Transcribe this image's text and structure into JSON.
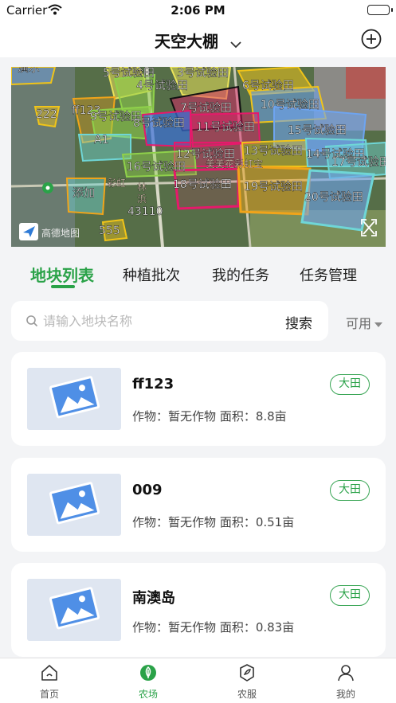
{
  "status_bar": {
    "carrier": "Carrier",
    "time": "2:06 PM"
  },
  "nav": {
    "title": "天空大棚",
    "add_icon": "plus-circle-icon",
    "dropdown_icon": "chevron-down-icon"
  },
  "map": {
    "plots": [
      {
        "label": "5号试验田",
        "color": "#e9e25a"
      },
      {
        "label": "3号试验田",
        "color": "#e9e25a"
      },
      {
        "label": "4号试验田",
        "color": "#8fd14a"
      },
      {
        "label": "6号试验田",
        "color": "#f0c419"
      },
      {
        "label": "7号试验田",
        "color": "#e6196b"
      },
      {
        "label": "10号试验田",
        "color": "#6ea4f0"
      },
      {
        "label": "ff123",
        "color": "#f0a41a"
      },
      {
        "label": "9号试验田",
        "color": "#8fd14a"
      },
      {
        "label": "8号试验田",
        "color": "#3a6fd8"
      },
      {
        "label": "11号试验田",
        "color": "#e6196b"
      },
      {
        "label": "15号试验田",
        "color": "#6ea4f0"
      },
      {
        "label": "222",
        "color": "#f0c419"
      },
      {
        "label": "A1",
        "color": "#6fd6d6"
      },
      {
        "label": "12号试验田",
        "color": "#e6196b"
      },
      {
        "label": "13号试验田",
        "color": "#f0c419"
      },
      {
        "label": "14号试验田",
        "color": "#6ea4f0"
      },
      {
        "label": "17号试验田",
        "color": "#6fd6d6"
      },
      {
        "label": "16号试验田",
        "color": "#8fd14a"
      },
      {
        "label": "18号试验田",
        "color": "#e6196b"
      },
      {
        "label": "19号试验田",
        "color": "#f0a41a"
      },
      {
        "label": "20号试验田",
        "color": "#6fd6d6"
      },
      {
        "label": "添加",
        "color": "#f0a41a"
      },
      {
        "label": "555",
        "color": "#f0c419"
      },
      {
        "label": "43110",
        "color": "#ffffff"
      },
      {
        "label": "演示",
        "color": "#f0c419"
      }
    ],
    "place_labels": [
      "美美花彩虹宝",
      "彩虹",
      "林",
      "浜"
    ],
    "watermark": "高德地图",
    "locate_icon": "navigation-arrow-icon",
    "fullscreen_icon": "expand-icon"
  },
  "tabs": [
    {
      "label": "地块列表",
      "active": true
    },
    {
      "label": "种植批次",
      "active": false
    },
    {
      "label": "我的任务",
      "active": false
    },
    {
      "label": "任务管理",
      "active": false
    }
  ],
  "search": {
    "placeholder": "请输入地块名称",
    "button_label": "搜索",
    "filter_label": "可用"
  },
  "plots_list": [
    {
      "name": "ff123",
      "crop_label": "作物：",
      "crop": "暂无作物",
      "area_label": "面积：",
      "area": "8.8亩",
      "badge": "大田"
    },
    {
      "name": "009",
      "crop_label": "作物：",
      "crop": "暂无作物",
      "area_label": "面积：",
      "area": "0.51亩",
      "badge": "大田"
    },
    {
      "name": "南澳岛",
      "crop_label": "作物：",
      "crop": "暂无作物",
      "area_label": "面积：",
      "area": "0.83亩",
      "badge": "大田"
    }
  ],
  "tabbar": [
    {
      "label": "首页",
      "icon": "home-icon",
      "active": false
    },
    {
      "label": "农场",
      "icon": "leaf-icon",
      "active": true
    },
    {
      "label": "农服",
      "icon": "service-shield-icon",
      "active": false
    },
    {
      "label": "我的",
      "icon": "person-icon",
      "active": false
    }
  ],
  "colors": {
    "accent": "#2aa248",
    "background": "#f3f4f6"
  }
}
